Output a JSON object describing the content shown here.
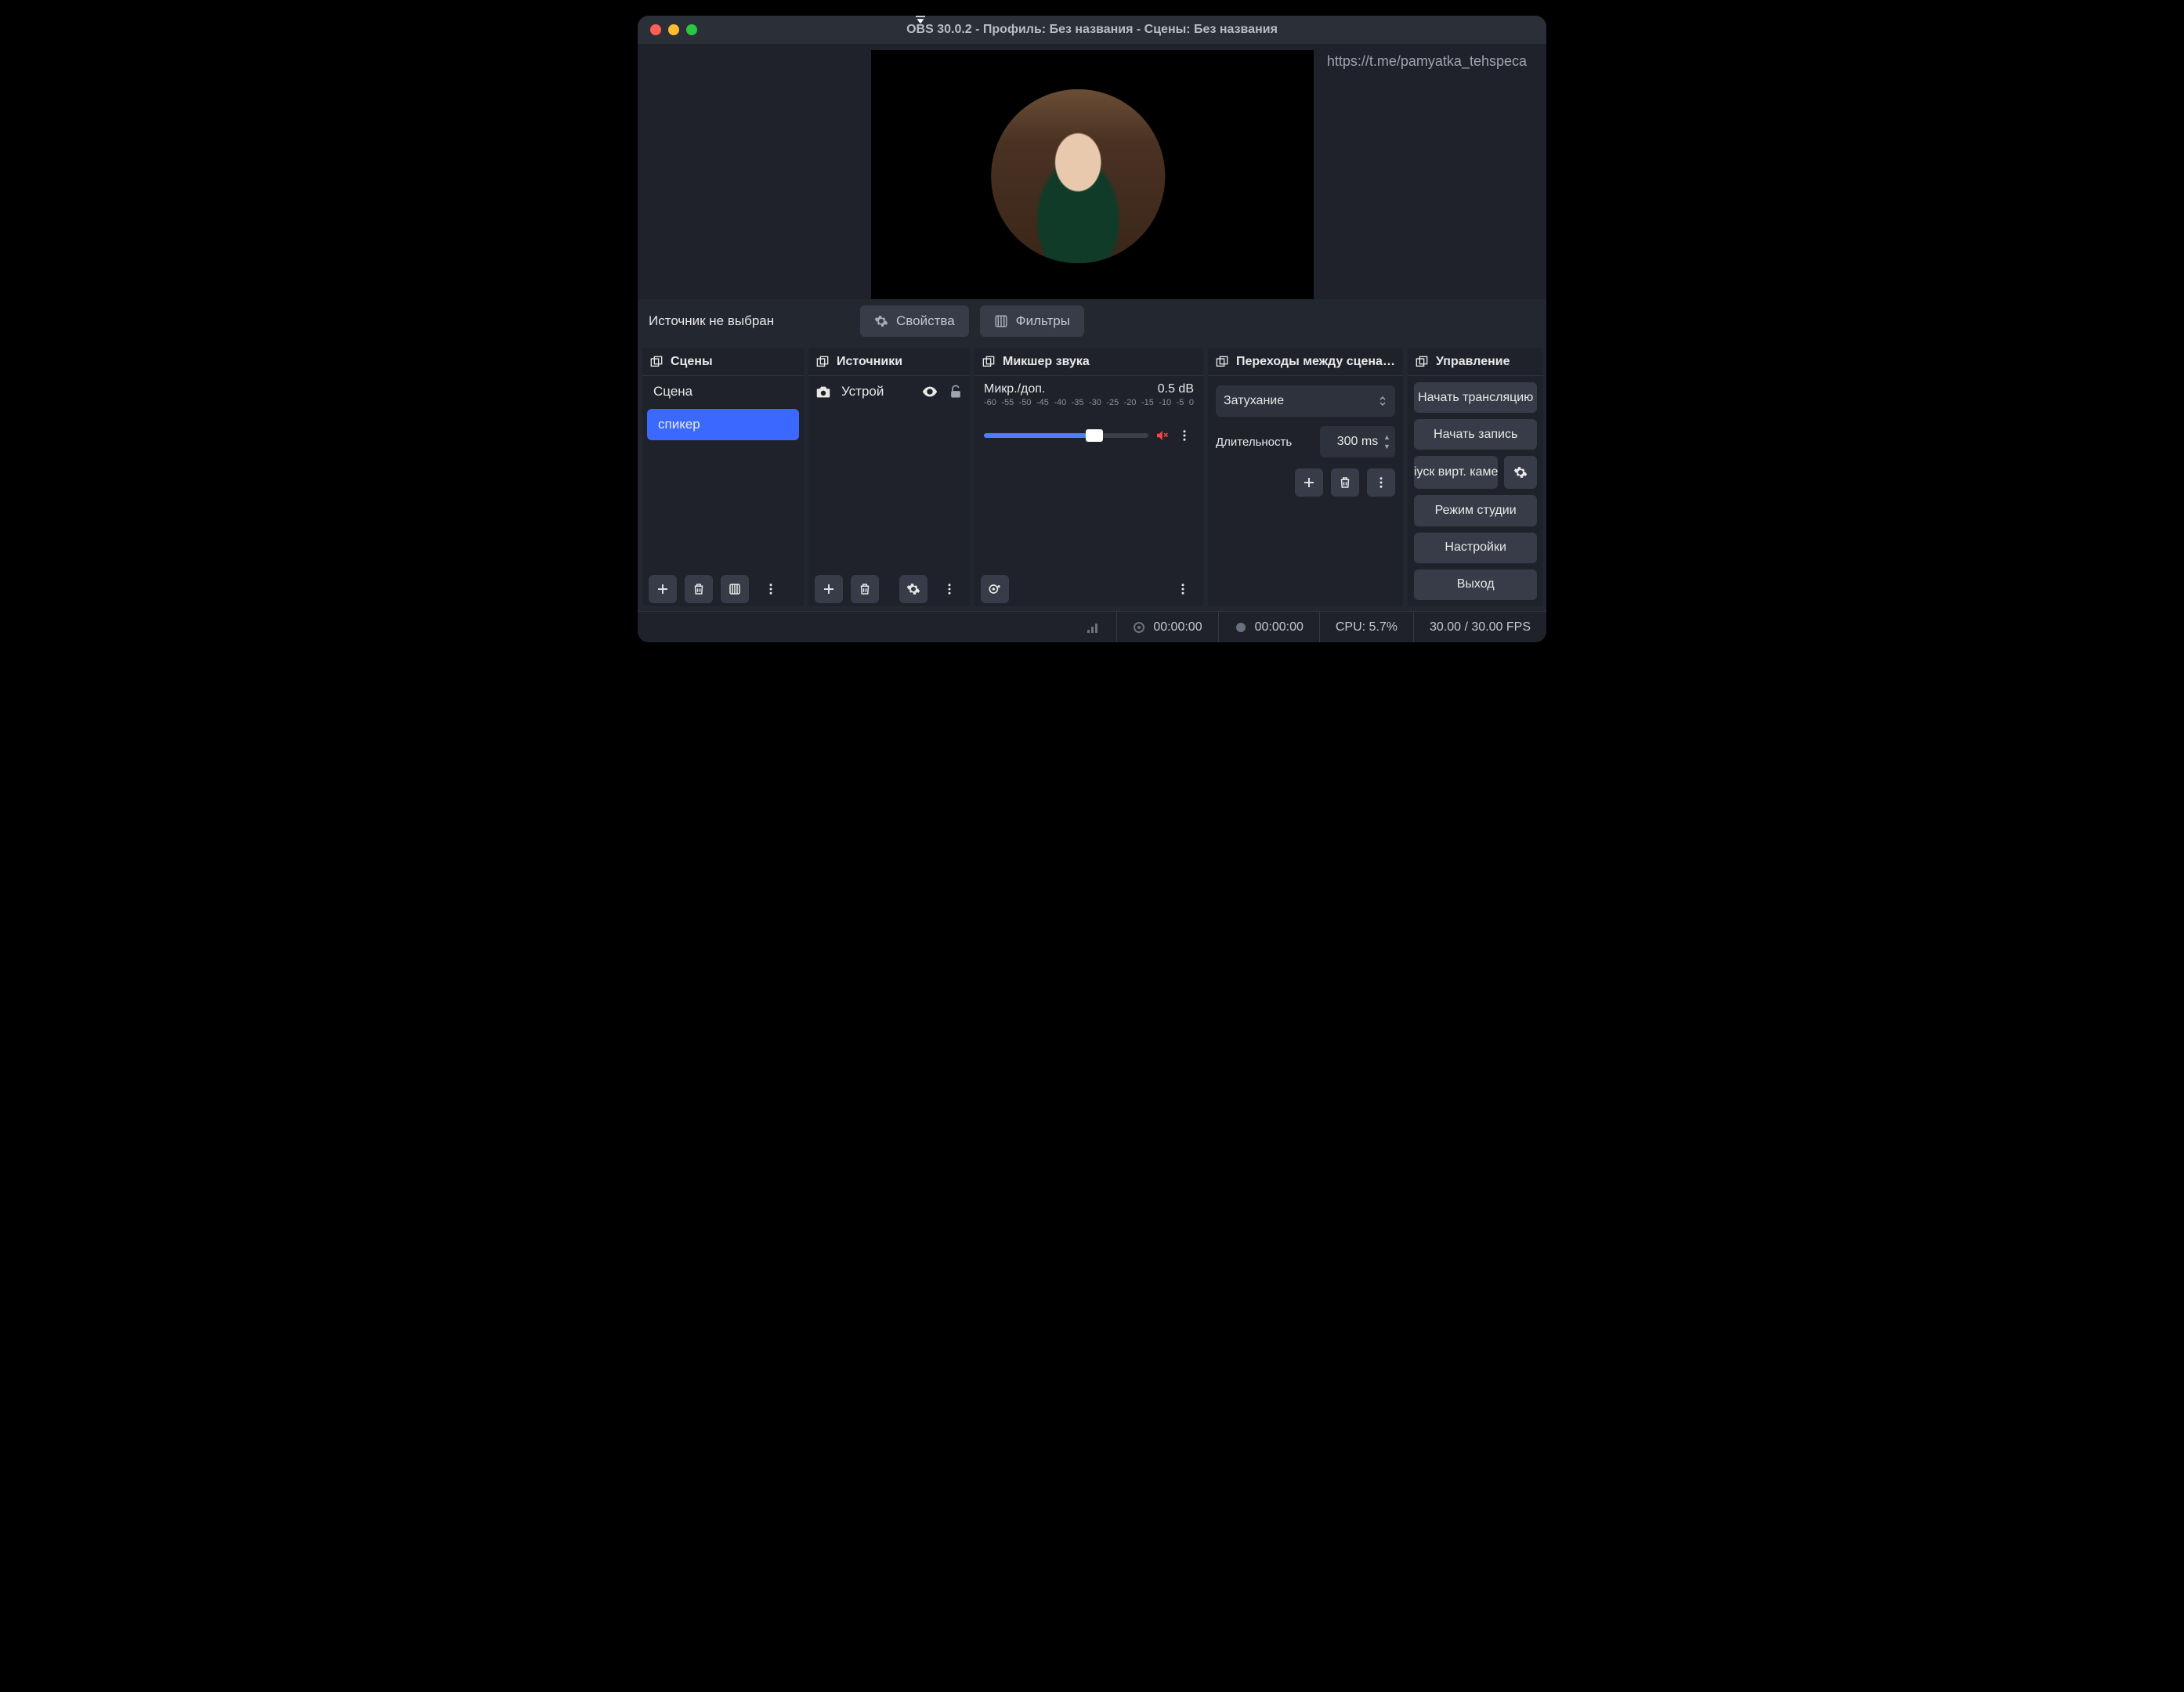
{
  "title": "OBS 30.0.2 - Профиль: Без названия - Сцены: Без названия",
  "overlay_url": "https://t.me/pamyatka_tehspeca",
  "toolbar": {
    "no_source": "Источник не выбран",
    "properties": "Свойства",
    "filters": "Фильтры"
  },
  "panels": {
    "scenes": {
      "title": "Сцены",
      "items": [
        "Сцена",
        "спикер"
      ],
      "selected_index": 1
    },
    "sources": {
      "title": "Источники",
      "items": [
        {
          "name": "Устрой",
          "visible": true,
          "locked": false
        }
      ]
    },
    "mixer": {
      "title": "Микшер звука",
      "channel_name": "Микр./доп.",
      "level_db": "0.5 dB",
      "ticks": [
        "-60",
        "-55",
        "-50",
        "-45",
        "-40",
        "-35",
        "-30",
        "-25",
        "-20",
        "-15",
        "-10",
        "-5",
        "0"
      ]
    },
    "transitions": {
      "title": "Переходы между сцена…",
      "selected": "Затухание",
      "duration_label": "Длительность",
      "duration_value": "300 ms"
    },
    "controls": {
      "title": "Управление",
      "buttons": {
        "start_stream": "Начать трансляцию",
        "start_record": "Начать запись",
        "virtual_cam": "іуск вирт. каме",
        "studio_mode": "Режим студии",
        "settings": "Настройки",
        "exit": "Выход"
      }
    }
  },
  "status": {
    "stream_time": "00:00:00",
    "record_time": "00:00:00",
    "cpu": "CPU: 5.7%",
    "fps": "30.00 / 30.00 FPS"
  }
}
